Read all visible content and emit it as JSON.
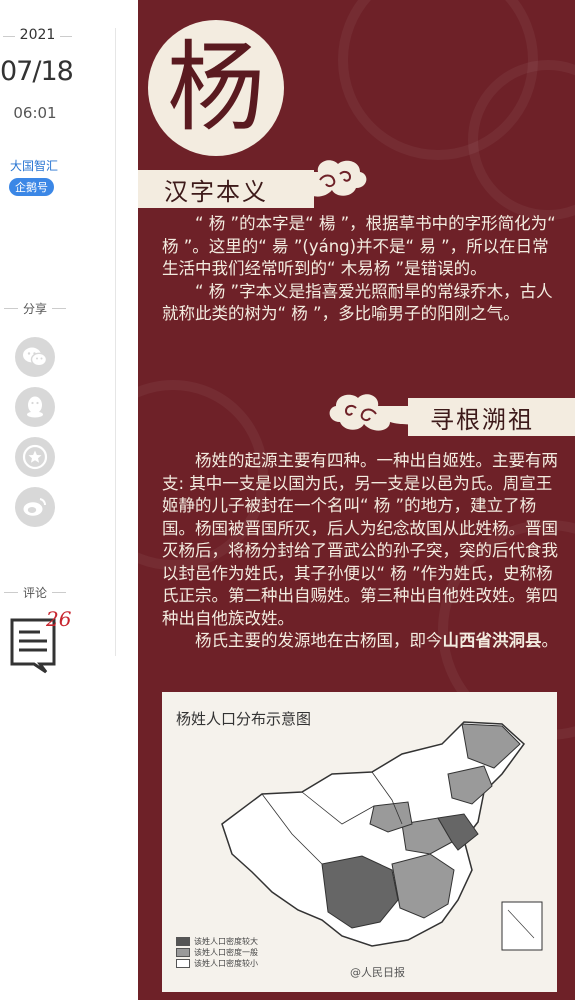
{
  "meta": {
    "year": "2021",
    "date": "07/18",
    "time": "06:01"
  },
  "author": {
    "name": "大国智汇",
    "badge": "企鹅号"
  },
  "share": {
    "label": "分享",
    "buttons": [
      "wechat-icon",
      "qq-icon",
      "favorite-icon",
      "weibo-icon"
    ]
  },
  "comments": {
    "label": "评论",
    "count": "26"
  },
  "poster": {
    "character": "杨",
    "section1_title": "汉字本义",
    "section1_p1": "“ 杨 ”的本字是“ 楊 ”，根据草书中的字形简化为“ 杨 ”。这里的“ 昜 ”(yáng)并不是“ 易 ”，所以在日常生活中我们经常听到的“ 木易杨 ”是错误的。",
    "section1_p2": "“ 杨 ”字本义是指喜爱光照耐旱的常绿乔木，古人就称此类的树为“ 杨 ”，多比喻男子的阳刚之气。",
    "section2_title": "寻根溯祖",
    "section2_p1": "杨姓的起源主要有四种。一种出自姬姓。主要有两支: 其中一支是以国为氏，另一支是以邑为氏。周宣王姬静的儿子被封在一个名叫“ 杨 ”的地方，建立了杨国。杨国被晋国所灭，后人为纪念故国从此姓杨。晋国灭杨后，将杨分封给了晋武公的孙子突，突的后代食我以封邑作为姓氏，其子孙便以“ 杨 ”作为姓氏，史称杨氏正宗。第二种出自赐姓。第三种出自他姓改姓。第四种出自他族改姓。",
    "section2_p2_prefix": "杨氏主要的发源地在古杨国，即今",
    "section2_p2_bold": "山西省洪洞县",
    "section2_p2_suffix": "。",
    "map_title": "杨姓人口分布示意图",
    "legend": [
      {
        "label": "该姓人口密度较大",
        "color": "#555555"
      },
      {
        "label": "该姓人口密度一般",
        "color": "#9a9a9a"
      },
      {
        "label": "该姓人口密度较小",
        "color": "#ffffff"
      }
    ],
    "watermark": "@人民日报"
  },
  "colors": {
    "poster_bg": "#6e2128",
    "cream": "#f3ece0",
    "link_blue": "#2a76d2",
    "comment_red": "#c8262f"
  }
}
